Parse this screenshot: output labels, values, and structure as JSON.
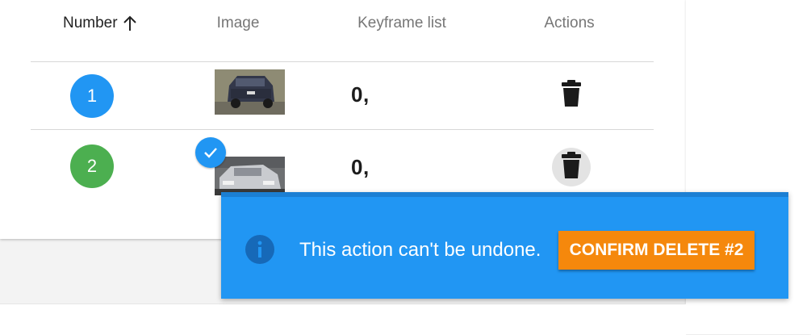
{
  "table": {
    "headers": {
      "number": "Number",
      "image": "Image",
      "keyframe_list": "Keyframe list",
      "actions": "Actions"
    },
    "sort": {
      "column": "number",
      "direction": "ascending",
      "icon": "arrow-up-icon"
    },
    "rows": [
      {
        "number": "1",
        "badge_color": "#2196f3",
        "keyframes": "0,",
        "selected": false
      },
      {
        "number": "2",
        "badge_color": "#4caf50",
        "keyframes": "0,",
        "selected": true
      }
    ]
  },
  "snackbar": {
    "icon": "info-icon",
    "message": "This action can't be undone.",
    "confirm_label": "CONFIRM DELETE #2",
    "background": "#2196f3",
    "button_color": "#f5880c"
  },
  "icons": {
    "delete": "trash-icon",
    "selected": "checkmark-icon"
  }
}
